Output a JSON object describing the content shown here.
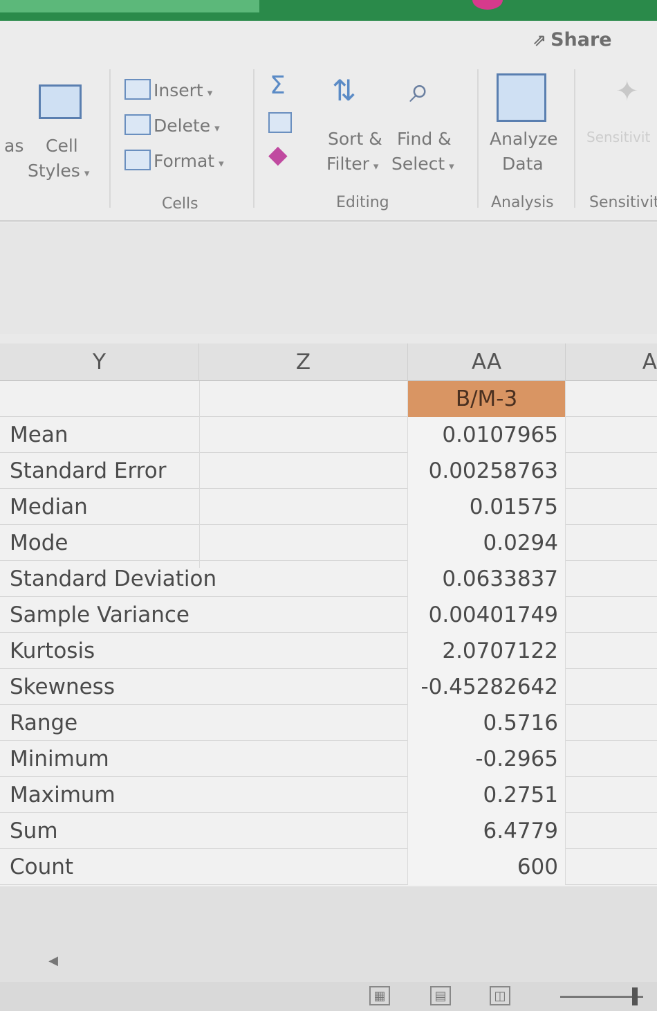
{
  "ribbon": {
    "share_label": "Share",
    "styles_partial_label": "as",
    "cell_styles_line1": "Cell",
    "cell_styles_line2": "Styles",
    "insert_label": "Insert",
    "delete_label": "Delete",
    "format_label": "Format",
    "cells_group": "Cells",
    "sort_filter_line1": "Sort &",
    "sort_filter_line2": "Filter",
    "find_select_line1": "Find &",
    "find_select_line2": "Select",
    "editing_group": "Editing",
    "analyze_line1": "Analyze",
    "analyze_line2": "Data",
    "analysis_group": "Analysis",
    "sensitivity_button": "Sensitivit",
    "sensitivity_group": "Sensitivit",
    "accent_color": "#2a8a4a"
  },
  "columns": [
    "Y",
    "Z",
    "AA",
    "A"
  ],
  "table": {
    "header": "B/M-3",
    "rows": [
      {
        "row_num": "",
        "label": "Mean",
        "value": "0.0107965"
      },
      {
        "row_num": "",
        "label": "Standard Error",
        "value": "0.00258763"
      },
      {
        "row_num": "",
        "label": "Median",
        "value": "0.01575"
      },
      {
        "row_num": "",
        "label": "Mode",
        "value": "0.0294"
      },
      {
        "row_num": "",
        "label": "Standard Deviation",
        "value": "0.0633837"
      },
      {
        "row_num": "",
        "label": "Sample Variance",
        "value": "0.00401749"
      },
      {
        "row_num": "",
        "label": "Kurtosis",
        "value": "2.0707122"
      },
      {
        "row_num": "",
        "label": "Skewness",
        "value": "-0.45282642"
      },
      {
        "row_num": "",
        "label": "Range",
        "value": "0.5716"
      },
      {
        "row_num": "",
        "label": "Minimum",
        "value": "-0.2965"
      },
      {
        "row_num": "",
        "label": "Maximum",
        "value": "0.2751"
      },
      {
        "row_num": "",
        "label": "Sum",
        "value": "6.4779"
      },
      {
        "row_num": "",
        "label": "Count",
        "value": "600"
      }
    ]
  }
}
